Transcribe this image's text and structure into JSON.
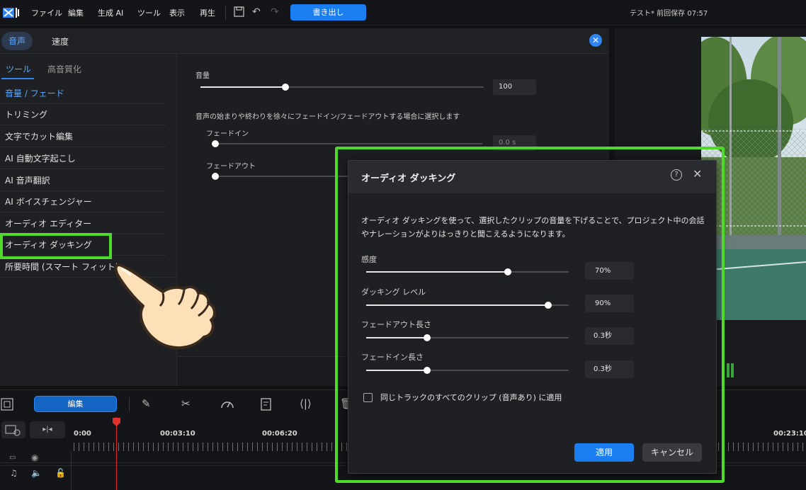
{
  "menubar": {
    "items": [
      "ファイル",
      "編集",
      "生成 AI",
      "ツール",
      "表示",
      "再生"
    ],
    "export_label": "書き出し",
    "project_title": "テスト* 前回保存 07:57"
  },
  "panel": {
    "tabs": [
      "音声",
      "速度"
    ],
    "sub_tabs": [
      "ツール",
      "高音質化"
    ],
    "sidebar_items": [
      "音量 / フェード",
      "トリミング",
      "文字でカット編集",
      "AI 自動文字起こし",
      "AI 音声翻訳",
      "AI ボイスチェンジャー",
      "オーディオ エディター",
      "オーディオ ダッキング",
      "所要時間 (スマート フィット)"
    ],
    "volume_label": "音量",
    "volume_value": "100",
    "volume_level": 0.3,
    "fade_note": "音声の始まりや終わりを徐々にフェードイン/フェードアウトする場合に選択します",
    "fade_in_label": "フェードイン",
    "fade_in_value": "0.0 s",
    "fade_out_label": "フェードアウト"
  },
  "dialog": {
    "title": "オーディオ ダッキング",
    "help_icon": "?",
    "description": "オーディオ ダッキングを使って、選択したクリップの音量を下げることで、プロジェクト中の会話やナレーションがよりはっきりと聞こえるようになります。",
    "sliders": [
      {
        "label": "感度",
        "value": "70%",
        "level": 0.7
      },
      {
        "label": "ダッキング レベル",
        "value": "90%",
        "level": 0.9
      },
      {
        "label": "フェードアウト長さ",
        "value": "0.3秒",
        "level": 0.3
      },
      {
        "label": "フェードイン長さ",
        "value": "0.3秒",
        "level": 0.3
      }
    ],
    "checkbox_label": "同じトラックのすべてのクリップ (音声あり) に適用",
    "apply_label": "適用",
    "cancel_label": "キャンセル"
  },
  "timeline": {
    "edit_label": "編集",
    "times": [
      "0:00",
      "00:03:10",
      "00:06:20",
      "00:23:10"
    ]
  },
  "colors": {
    "accent": "#1b7ef0",
    "highlight": "#4fd92b",
    "playhead": "#e0302b"
  }
}
